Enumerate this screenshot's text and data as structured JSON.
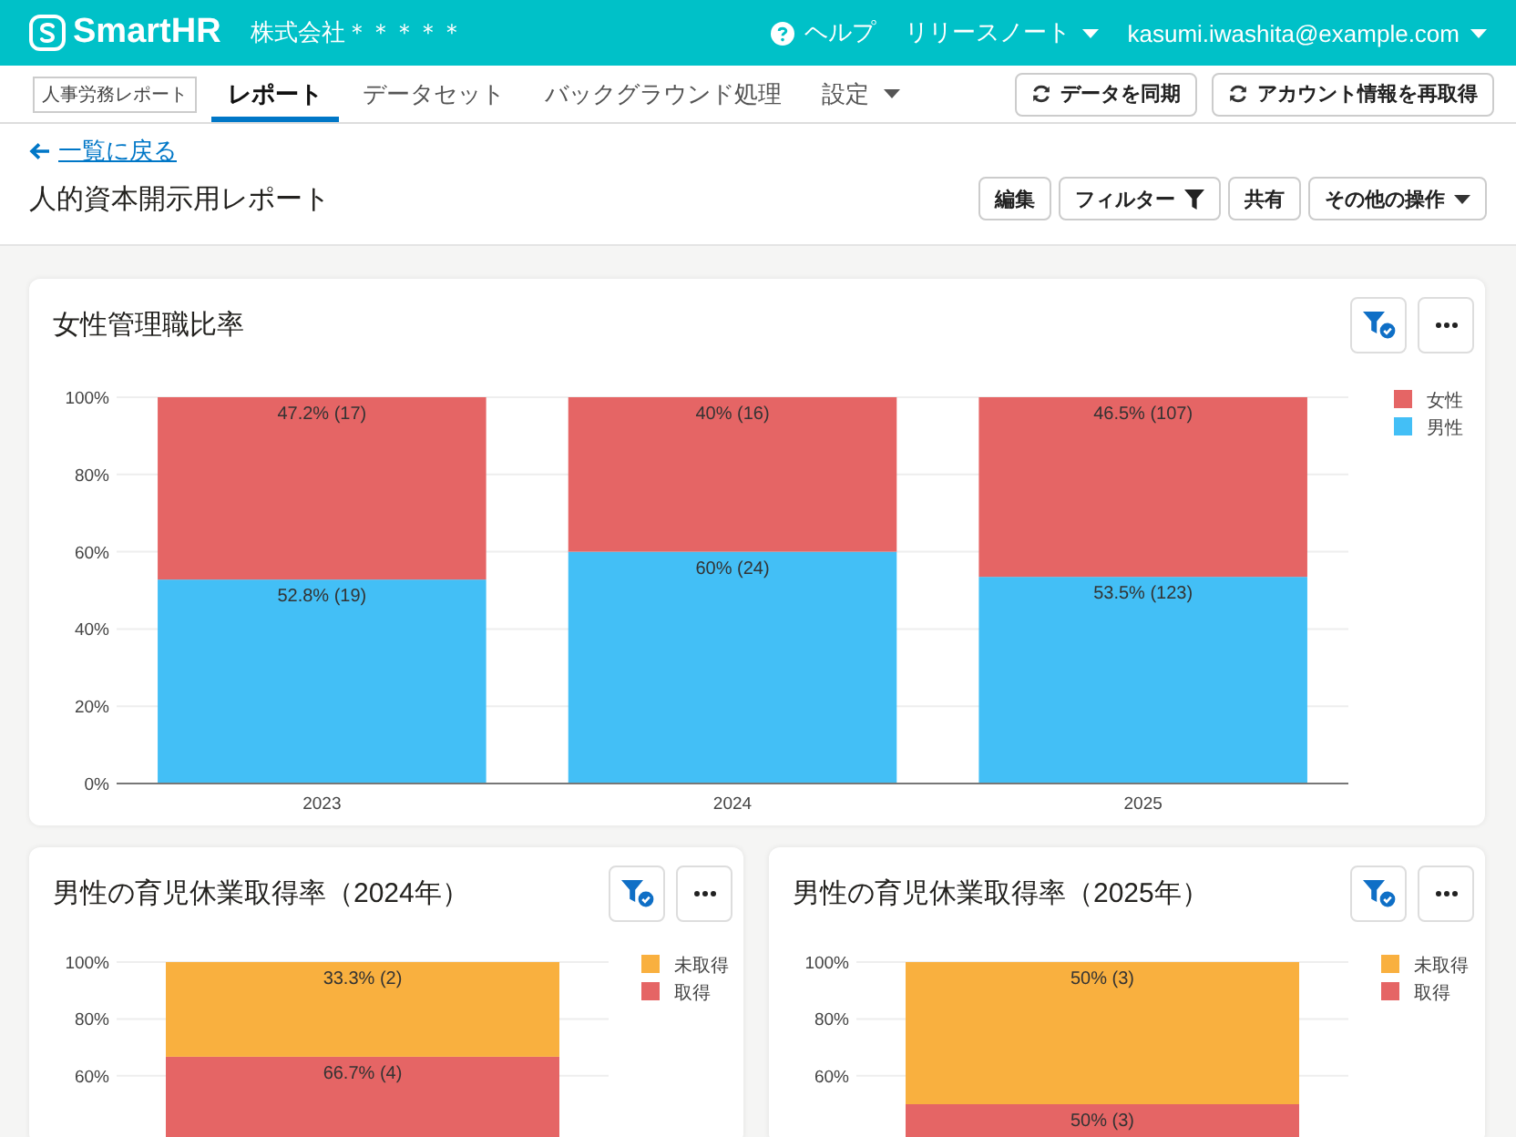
{
  "header": {
    "logo": "SmartHR",
    "company": "株式会社＊＊＊＊＊",
    "links": [
      {
        "label": "ヘルプ",
        "kind": "help"
      },
      {
        "label": "リリースノート",
        "kind": "dropdown"
      },
      {
        "label": "kasumi.iwashita@example.com",
        "kind": "dropdown"
      }
    ]
  },
  "nav": {
    "badge": "人事労務レポート",
    "tabs": [
      {
        "label": "レポート",
        "selected": true,
        "dropdown": false
      },
      {
        "label": "データセット",
        "selected": false,
        "dropdown": false
      },
      {
        "label": "バックグラウンド処理",
        "selected": false,
        "dropdown": false
      },
      {
        "label": "設定",
        "selected": false,
        "dropdown": true
      }
    ],
    "actions": [
      "データを同期",
      "アカウント情報を再取得"
    ]
  },
  "page": {
    "back_link": "一覧に戻る",
    "title": "人的資本開示用レポート",
    "actions": [
      {
        "label": "編集",
        "kind": "plain"
      },
      {
        "label": "フィルター",
        "kind": "filter"
      },
      {
        "label": "共有",
        "kind": "plain"
      },
      {
        "label": "その他の操作",
        "kind": "dropdown"
      }
    ]
  },
  "cards": [
    {
      "title": "女性管理職比率",
      "kind": "wide",
      "chart_data": {
        "type": "bar",
        "stacked": true,
        "grid": true,
        "legend": true,
        "categories": [
          "2023",
          "2024",
          "2025"
        ],
        "ylim": [
          0,
          100
        ],
        "yticks": [
          {
            "value": 0,
            "label": "0%"
          },
          {
            "value": 20,
            "label": "20%"
          },
          {
            "value": 40,
            "label": "40%"
          },
          {
            "value": 60,
            "label": "60%"
          },
          {
            "value": 80,
            "label": "80%"
          },
          {
            "value": 100,
            "label": "100%"
          }
        ],
        "series": [
          {
            "name": "女性",
            "color": "#e56565",
            "values": [
              47.2,
              40,
              46.5
            ]
          },
          {
            "name": "男性",
            "color": "#43bff6",
            "values": [
              52.8,
              60,
              53.5
            ]
          }
        ],
        "value_labels": [
          [
            "47.2% (17)",
            "40% (16)",
            "46.5% (107)"
          ],
          [
            "52.8% (19)",
            "60% (24)",
            "53.5% (123)"
          ]
        ]
      }
    },
    {
      "title": "男性の育児休業取得率（2024年）",
      "kind": "half",
      "chart_data": {
        "type": "bar",
        "stacked": true,
        "grid": true,
        "legend": true,
        "ylim": [
          0,
          100
        ],
        "yticks": [
          {
            "value": 60,
            "label": "60%"
          },
          {
            "value": 80,
            "label": "80%"
          },
          {
            "value": 100,
            "label": "100%"
          }
        ],
        "series": [
          {
            "name": "未取得",
            "color": "#f9b03f",
            "values": [
              33.3
            ]
          },
          {
            "name": "取得",
            "color": "#e56565",
            "values": [
              66.7
            ]
          }
        ],
        "value_labels": [
          [
            "33.3% (2)"
          ],
          [
            "66.7% (4)"
          ]
        ]
      }
    },
    {
      "title": "男性の育児休業取得率（2025年）",
      "kind": "half",
      "chart_data": {
        "type": "bar",
        "stacked": true,
        "grid": true,
        "legend": true,
        "ylim": [
          0,
          100
        ],
        "yticks": [
          {
            "value": 60,
            "label": "60%"
          },
          {
            "value": 80,
            "label": "80%"
          },
          {
            "value": 100,
            "label": "100%"
          }
        ],
        "series": [
          {
            "name": "未取得",
            "color": "#f9b03f",
            "values": [
              50
            ]
          },
          {
            "name": "取得",
            "color": "#e56565",
            "values": [
              50
            ]
          }
        ],
        "value_labels": [
          [
            "50% (3)"
          ],
          [
            "50% (3)"
          ]
        ]
      }
    }
  ]
}
